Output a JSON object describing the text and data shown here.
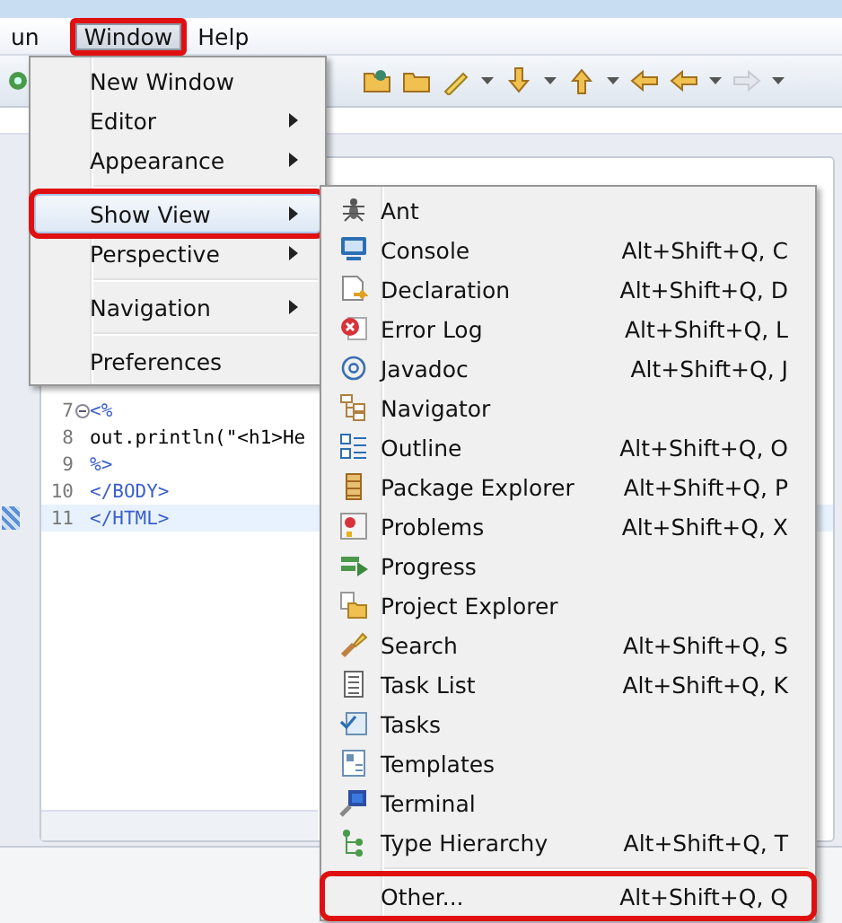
{
  "menubar": [
    {
      "label": "un",
      "selected": false,
      "highlighted": false
    },
    {
      "label": "Window",
      "selected": true,
      "highlighted": true
    },
    {
      "label": "Help",
      "selected": false,
      "highlighted": false
    }
  ],
  "window_menu": [
    {
      "kind": "item",
      "label": "New Window",
      "submenu": false,
      "selected": false,
      "highlighted": false
    },
    {
      "kind": "item",
      "label": "Editor",
      "submenu": true,
      "selected": false,
      "highlighted": false
    },
    {
      "kind": "item",
      "label": "Appearance",
      "submenu": true,
      "selected": false,
      "highlighted": false
    },
    {
      "kind": "separator"
    },
    {
      "kind": "item",
      "label": "Show View",
      "submenu": true,
      "selected": true,
      "highlighted": true
    },
    {
      "kind": "item",
      "label": "Perspective",
      "submenu": true,
      "selected": false,
      "highlighted": false
    },
    {
      "kind": "separator"
    },
    {
      "kind": "item",
      "label": "Navigation",
      "submenu": true,
      "selected": false,
      "highlighted": false
    },
    {
      "kind": "separator"
    },
    {
      "kind": "item",
      "label": "Preferences",
      "submenu": false,
      "selected": false,
      "highlighted": false
    }
  ],
  "show_view_menu": [
    {
      "kind": "item",
      "label": "Ant",
      "highlighted": false
    },
    {
      "kind": "item",
      "label": "Console",
      "shortcut": "Alt+Shift+Q, C",
      "highlighted": false
    },
    {
      "kind": "item",
      "label": "Declaration",
      "shortcut": "Alt+Shift+Q, D",
      "highlighted": false
    },
    {
      "kind": "item",
      "label": "Error Log",
      "shortcut": "Alt+Shift+Q, L",
      "highlighted": false
    },
    {
      "kind": "item",
      "label": "Javadoc",
      "shortcut": "Alt+Shift+Q, J",
      "highlighted": false
    },
    {
      "kind": "item",
      "label": "Navigator",
      "highlighted": false
    },
    {
      "kind": "item",
      "label": "Outline",
      "shortcut": "Alt+Shift+Q, O",
      "highlighted": false
    },
    {
      "kind": "item",
      "label": "Package Explorer",
      "shortcut": "Alt+Shift+Q, P",
      "highlighted": false
    },
    {
      "kind": "item",
      "label": "Problems",
      "shortcut": "Alt+Shift+Q, X",
      "highlighted": false
    },
    {
      "kind": "item",
      "label": "Progress",
      "highlighted": false
    },
    {
      "kind": "item",
      "label": "Project Explorer",
      "highlighted": false
    },
    {
      "kind": "item",
      "label": "Search",
      "shortcut": "Alt+Shift+Q, S",
      "highlighted": false
    },
    {
      "kind": "item",
      "label": "Task List",
      "shortcut": "Alt+Shift+Q, K",
      "highlighted": false
    },
    {
      "kind": "item",
      "label": "Tasks",
      "highlighted": false
    },
    {
      "kind": "item",
      "label": "Templates",
      "highlighted": false
    },
    {
      "kind": "item",
      "label": "Terminal",
      "highlighted": false
    },
    {
      "kind": "item",
      "label": "Type Hierarchy",
      "shortcut": "Alt+Shift+Q, T",
      "highlighted": false
    },
    {
      "kind": "separator"
    },
    {
      "kind": "item",
      "label": "Other...",
      "shortcut": "Alt+Shift+Q, Q",
      "highlighted": true
    }
  ],
  "editor": {
    "lines": [
      {
        "number": "7",
        "code": "<%",
        "foldable": true,
        "current": false,
        "kind": "tag"
      },
      {
        "number": "8",
        "code": "out.println(\"<h1>He",
        "foldable": false,
        "current": false,
        "kind": "plain"
      },
      {
        "number": "9",
        "code": "%>",
        "foldable": false,
        "current": false,
        "kind": "tag"
      },
      {
        "number": "10",
        "code": "</BODY>",
        "foldable": false,
        "current": false,
        "kind": "tag"
      },
      {
        "number": "11",
        "code": "</HTML>",
        "foldable": false,
        "current": true,
        "kind": "tag"
      }
    ]
  }
}
